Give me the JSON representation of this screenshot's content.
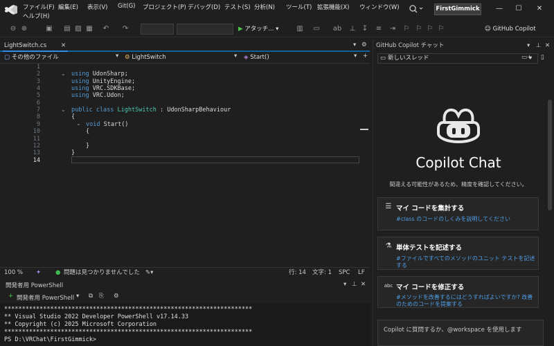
{
  "menu": {
    "items": [
      "ファイル(F)",
      "編集(E)",
      "表示(V)",
      "Git(G)",
      "プロジェクト(P)",
      "デバッグ(D)",
      "テスト(S)",
      "分析(N)",
      "ツール(T)",
      "拡張機能(X)",
      "ウィンドウ(W)"
    ],
    "help": "ヘルプ(H)"
  },
  "solution_name": "FirstGimmick",
  "window_controls": {
    "minimize": "—",
    "maximize": "☐",
    "close": "✕"
  },
  "toolbar": {
    "attach_label": "アタッチ...",
    "copilot_label": "GitHub Copilot"
  },
  "editor": {
    "tab_label": "LightSwitch.cs",
    "tab_close": "✕",
    "nav_project": "その他のファイル",
    "nav_class": "LightSwitch",
    "nav_member": "Start()",
    "line_numbers": [
      "1",
      "2",
      "3",
      "4",
      "5",
      "6",
      "7",
      "8",
      "9",
      "10",
      "11",
      "12",
      "13",
      "14"
    ],
    "code": [
      {
        "kw": "",
        "rest": ""
      },
      {
        "kw": "using",
        "rest": " UdonSharp;"
      },
      {
        "kw": "using",
        "rest": " UnityEngine;"
      },
      {
        "kw": "using",
        "rest": " VRC.SDKBase;"
      },
      {
        "kw": "using",
        "rest": " VRC.Udon;"
      },
      {
        "kw": "",
        "rest": ""
      },
      {
        "kw": "public class",
        "ty": " LightSwitch",
        "rest": " : UdonSharpBehaviour"
      },
      {
        "kw": "",
        "rest": "{"
      },
      {
        "kw": "void",
        "rest": " Start()"
      },
      {
        "kw": "",
        "rest": "{"
      },
      {
        "kw": "",
        "rest": ""
      },
      {
        "kw": "",
        "rest": "}"
      },
      {
        "kw": "",
        "rest": "}"
      },
      {
        "kw": "",
        "rest": ""
      }
    ],
    "status": {
      "zoom": "100 %",
      "issues": "問題は見つかりませんでした",
      "line": "行: 14",
      "char": "文字: 1",
      "spc": "SPC",
      "lf": "LF"
    }
  },
  "terminal": {
    "header": "開発者用 PowerShell",
    "new_label": "開発者用 PowerShell",
    "lines": [
      "**********************************************************************",
      "** Visual Studio 2022 Developer PowerShell v17.14.33",
      "** Copyright (c) 2025 Microsoft Corporation",
      "**********************************************************************",
      "PS D:\\VRChat\\FirstGimmick>"
    ]
  },
  "copilot": {
    "header": "GitHub Copilot チャット",
    "thread": "新しいスレッド",
    "title": "Copilot Chat",
    "subtitle": "間違える可能性があるため、精度を確認してください。",
    "suggestions": [
      {
        "icon": "list-icon",
        "title": "マイ コードを集計する",
        "desc": "#class のコードのしくみを説明してください"
      },
      {
        "icon": "flask-icon",
        "title": "単体テストを記述する",
        "desc": "#ファイルですべてのメソッドのユニット テストを記述する"
      },
      {
        "icon": "abc-icon",
        "title": "マイ コードを修正する",
        "desc": "#メソッドを改善するにはどうすればよいですか? 改善のためのコードを提案する"
      }
    ],
    "input_placeholder": "Copilot に質問するか、@workspace を使用します"
  }
}
